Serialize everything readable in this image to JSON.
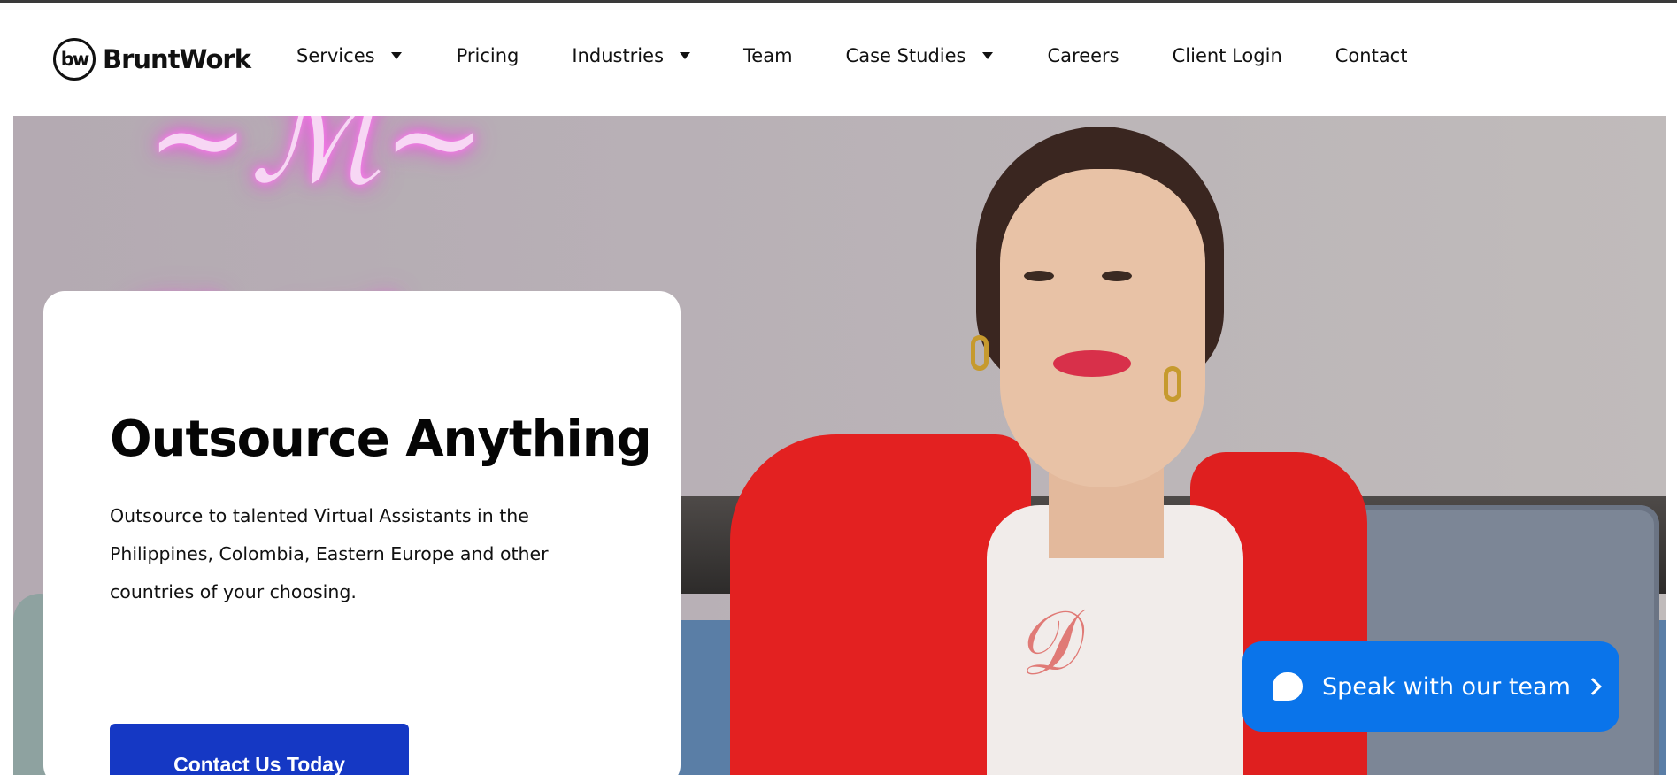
{
  "brand": {
    "logo_mark": "bw",
    "name": "BruntWork"
  },
  "nav": {
    "items": [
      {
        "label": "Services",
        "has_dropdown": true
      },
      {
        "label": "Pricing",
        "has_dropdown": false
      },
      {
        "label": "Industries",
        "has_dropdown": true
      },
      {
        "label": "Team",
        "has_dropdown": false
      },
      {
        "label": "Case Studies",
        "has_dropdown": true
      },
      {
        "label": "Careers",
        "has_dropdown": false
      },
      {
        "label": "Client Login",
        "has_dropdown": false
      },
      {
        "label": "Contact",
        "has_dropdown": false
      }
    ]
  },
  "hero": {
    "title": "Outsource Anything",
    "description": "Outsource to talented Virtual Assistants in the Philippines, Colombia, Eastern Europe and other countries of your choosing.",
    "cta_label": "Contact Us Today"
  },
  "chat_widget": {
    "label": "Speak with our team",
    "icon": "chat-bubble-icon",
    "arrow": "chevron-right-icon"
  },
  "colors": {
    "cta": "#1538c4",
    "chat": "#0a74ea",
    "jacket": "#e32121"
  }
}
